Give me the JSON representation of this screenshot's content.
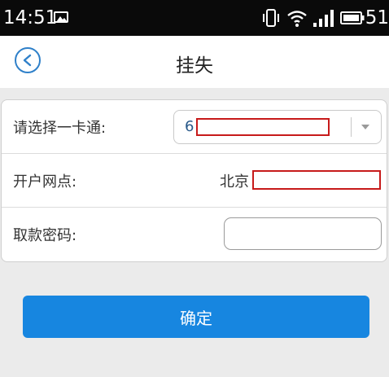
{
  "status_bar": {
    "time": "14:51",
    "battery_level": "51",
    "icons": [
      "photo-icon",
      "vibrate-icon",
      "wifi-icon",
      "signal-icon",
      "battery-icon"
    ]
  },
  "navbar": {
    "title": "挂失",
    "back_icon": "chevron-left-icon"
  },
  "form": {
    "card_label": "请选择一卡通:",
    "card_value": "6",
    "branch_label": "开户网点:",
    "branch_value": "北京",
    "password_label": "取款密码:",
    "password_value": ""
  },
  "actions": {
    "confirm_label": "确定"
  },
  "colors": {
    "accent": "#1786e0",
    "back_icon": "#2f80c9",
    "redaction": "#c71a1a",
    "background": "#ebebeb"
  }
}
